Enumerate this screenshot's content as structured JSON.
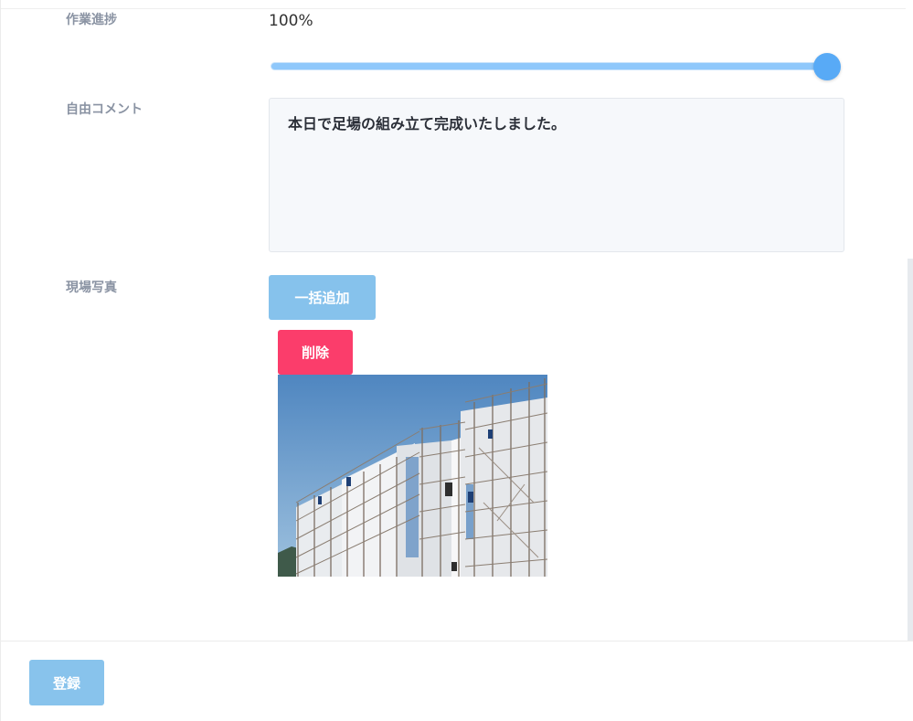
{
  "fields": {
    "progress_label": "作業進捗",
    "progress_text": "100%",
    "progress_value": 100,
    "comment_label": "自由コメント",
    "comment_value": "本日で足場の組み立て完成いたしました。",
    "photo_label": "現場写真"
  },
  "buttons": {
    "bulk_add": "一括追加",
    "delete": "削除",
    "submit": "登録"
  },
  "colors": {
    "slider_track": "#8fc8fb",
    "slider_thumb": "#58aaf6",
    "bulk_add_bg": "#86c2ec",
    "delete_bg": "#fb3d6b",
    "submit_bg": "#88c3ec"
  }
}
